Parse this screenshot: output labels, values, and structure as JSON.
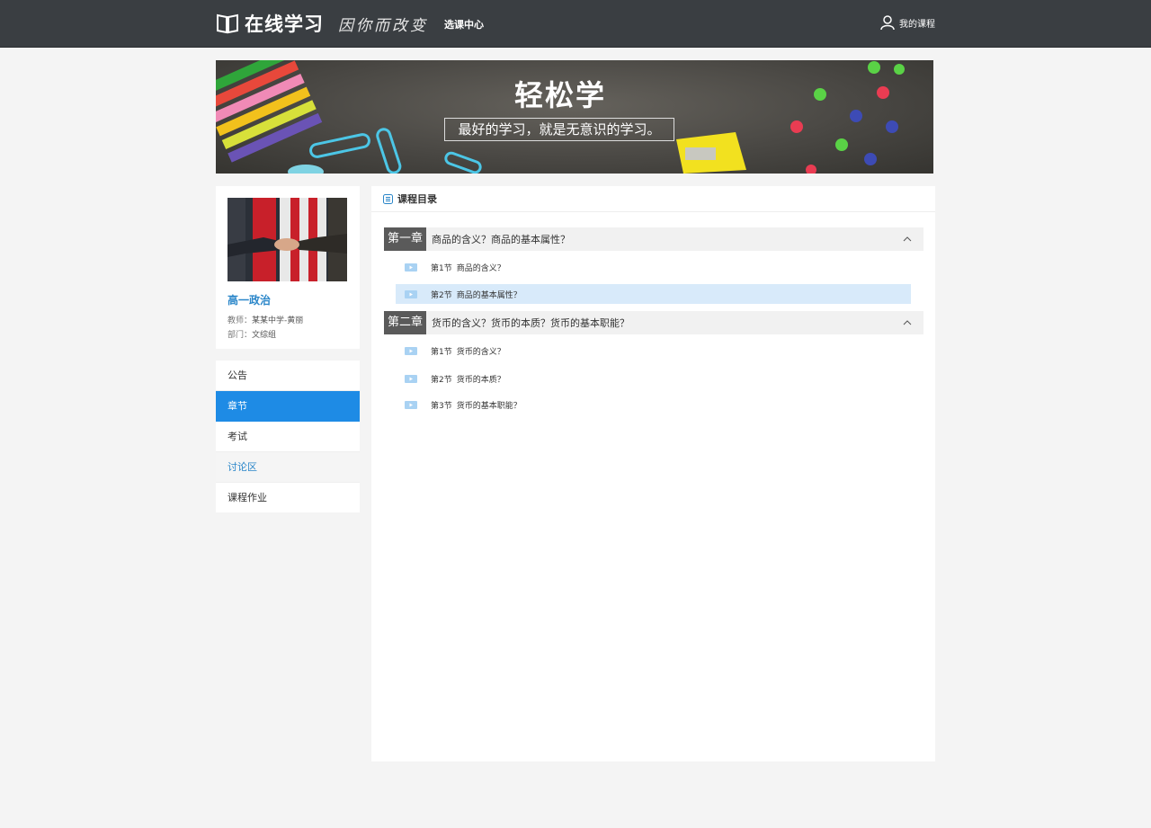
{
  "header": {
    "logo_text": "在线学习",
    "slogan": "因你而改变",
    "nav_label": "选课中心",
    "my_course_label": "我的课程"
  },
  "banner": {
    "title": "轻松学",
    "subtitle": "最好的学习，就是无意识的学习。"
  },
  "course": {
    "name": "高一政治",
    "teacher_label": "教师：",
    "teacher": "某某中学-黄丽",
    "dept_label": "部门：",
    "dept": "文综组"
  },
  "menu": {
    "items": [
      {
        "label": "公告"
      },
      {
        "label": "章节"
      },
      {
        "label": "考试"
      },
      {
        "label": "讨论区"
      },
      {
        "label": "课程作业"
      }
    ]
  },
  "catalog": {
    "title": "课程目录",
    "chapters": [
      {
        "num": "第一章",
        "title": "商品的含义？商品的基本属性？",
        "sections": [
          {
            "no": "第1节",
            "title": "商品的含义？"
          },
          {
            "no": "第2节",
            "title": "商品的基本属性？"
          }
        ]
      },
      {
        "num": "第二章",
        "title": "货币的含义？货币的本质？货币的基本职能？",
        "sections": [
          {
            "no": "第1节",
            "title": "货币的含义？"
          },
          {
            "no": "第2节",
            "title": "货币的本质？"
          },
          {
            "no": "第3节",
            "title": "货币的基本职能？"
          }
        ]
      }
    ]
  },
  "colors": {
    "topbar": "#3a3e42",
    "accent": "#1e8be5",
    "link": "#2a86c9",
    "chapter_num_bg": "#5a5a5a",
    "active_section_bg": "#d8eafa"
  }
}
